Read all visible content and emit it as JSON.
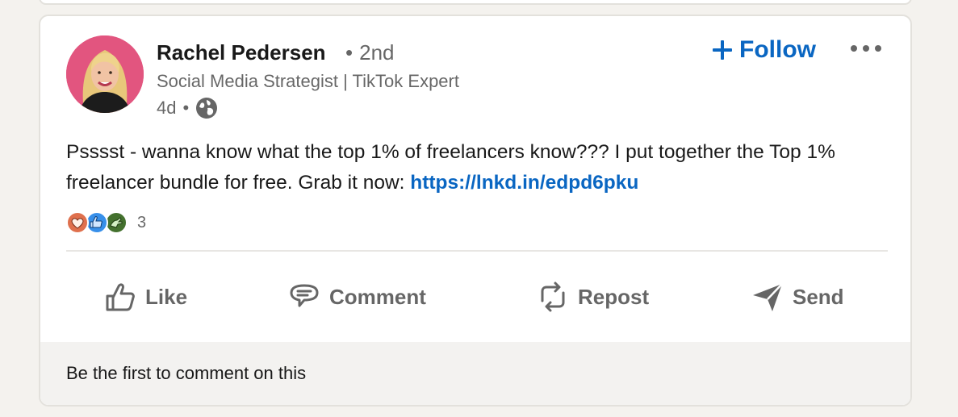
{
  "post": {
    "author": {
      "name": "Rachel Pedersen",
      "degree": "2nd",
      "headline": "Social Media Strategist | TikTok Expert",
      "posted_ago": "4d",
      "visibility_icon": "globe-icon"
    },
    "follow_label": "Follow",
    "more_icon": "ellipsis-icon",
    "text_before_link": "Psssst - wanna know what the top 1% of freelancers know??? I put together the Top 1% freelancer bundle for free. Grab it now: ",
    "link_text": "https://lnkd.in/edpd6pku",
    "reactions": {
      "icons": [
        "love-reaction-icon",
        "like-reaction-icon",
        "support-reaction-icon"
      ],
      "count": "3"
    },
    "actions": [
      {
        "label": "Like",
        "icon": "thumbs-up-icon"
      },
      {
        "label": "Comment",
        "icon": "comment-icon"
      },
      {
        "label": "Repost",
        "icon": "repost-icon"
      },
      {
        "label": "Send",
        "icon": "send-icon"
      }
    ],
    "empty_comments_text": "Be the first to comment on this"
  },
  "colors": {
    "link_blue": "#0a66c2",
    "card_bg": "#ffffff",
    "page_bg": "#f4f2ee",
    "footer_bg": "#f3f2f0",
    "muted_text": "#666666",
    "avatar_bg": "#e2557f"
  }
}
